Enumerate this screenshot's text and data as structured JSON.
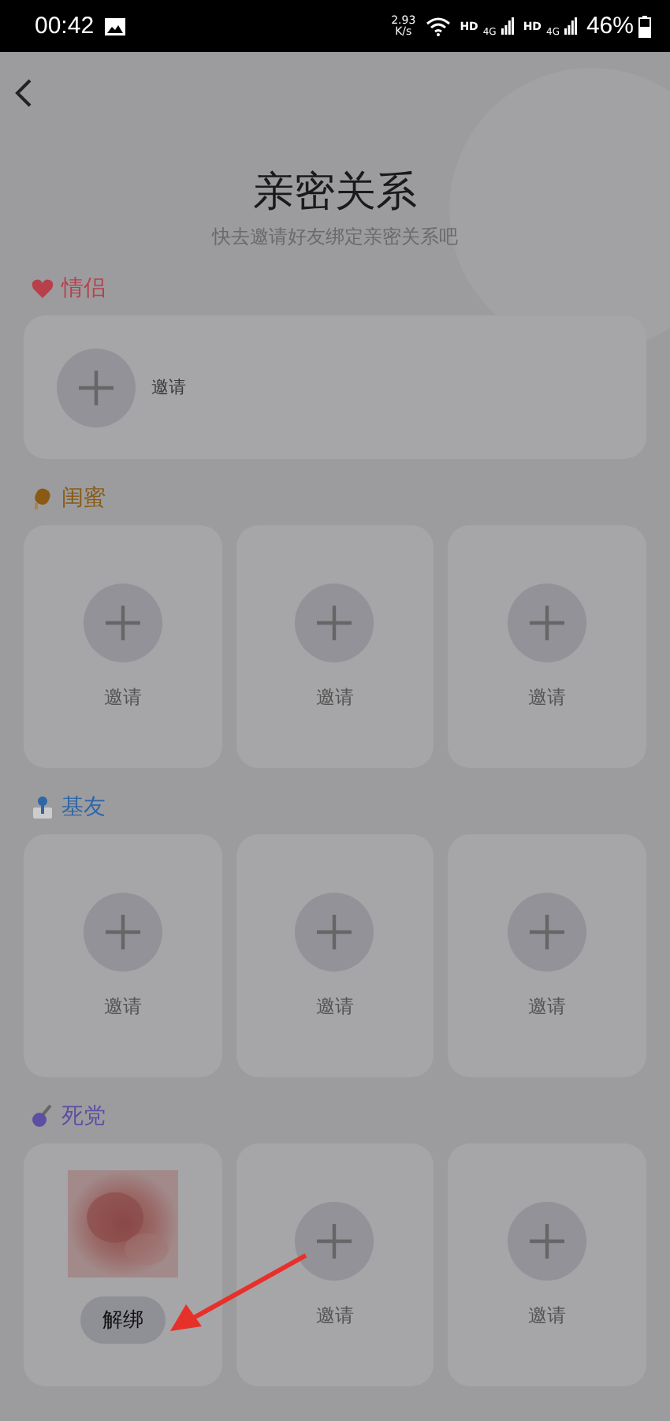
{
  "status_bar": {
    "time": "00:42",
    "speed_value": "2.93",
    "speed_unit": "K/s",
    "sim_1": {
      "hd": "HD",
      "network": "4G"
    },
    "sim_2": {
      "hd": "HD",
      "network": "4G"
    },
    "battery": "46%"
  },
  "header": {
    "title": "亲密关系",
    "subtitle": "快去邀请好友绑定亲密关系吧"
  },
  "sections": [
    {
      "title": "情侣",
      "color": "#b8404b",
      "kind": "single",
      "slots": [
        {
          "kind": "invite",
          "label": "邀请"
        }
      ]
    },
    {
      "title": "闺蜜",
      "color": "#8a5a14",
      "kind": "grid",
      "slots": [
        {
          "kind": "invite",
          "label": "邀请"
        },
        {
          "kind": "invite",
          "label": "邀请"
        },
        {
          "kind": "invite",
          "label": "邀请"
        }
      ]
    },
    {
      "title": "基友",
      "color": "#2f66a8",
      "kind": "grid",
      "slots": [
        {
          "kind": "invite",
          "label": "邀请"
        },
        {
          "kind": "invite",
          "label": "邀请"
        },
        {
          "kind": "invite",
          "label": "邀请"
        }
      ]
    },
    {
      "title": "死党",
      "color": "#5b4fa3",
      "kind": "grid",
      "slots": [
        {
          "kind": "bound",
          "button": "解绑"
        },
        {
          "kind": "invite",
          "label": "邀请"
        },
        {
          "kind": "invite",
          "label": "邀请"
        }
      ]
    }
  ]
}
